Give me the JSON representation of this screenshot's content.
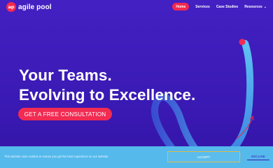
{
  "brand": {
    "logo_mark": "ap",
    "name": "agile pool",
    "color": "#f5284f"
  },
  "nav": {
    "items": [
      {
        "label": "Home",
        "active": true
      },
      {
        "label": "Services",
        "active": false
      },
      {
        "label": "Case Studies",
        "active": false
      },
      {
        "label": "Resources",
        "active": false,
        "has_dropdown": true
      }
    ],
    "dropdown_icon": "chevron-down-icon"
  },
  "hero": {
    "headline_line1": "Your Teams.",
    "headline_line2": "Evolving to Excellence.",
    "cta_label": "GET A FREE CONSULTATION",
    "background_color": "#3f1fb5",
    "accent_color": "#f22b52"
  },
  "cookie_banner": {
    "text": "This website uses cookies to ensure you get the best experience on our website.",
    "accept_label": "ACCEPT",
    "decline_label": "DECLINE",
    "background_color": "#55b9ec"
  }
}
